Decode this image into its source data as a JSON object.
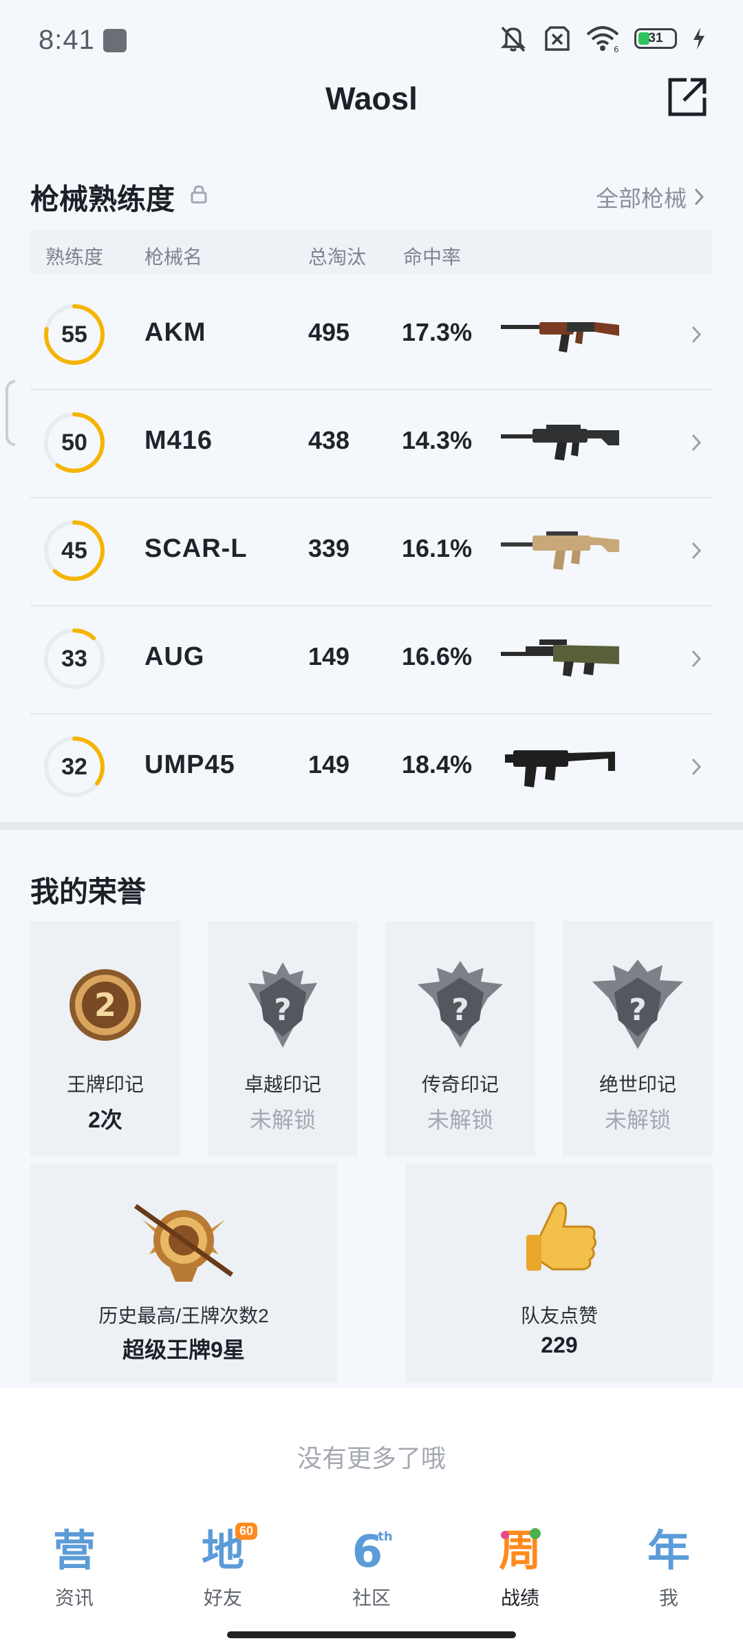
{
  "status_bar": {
    "time": "8:41",
    "battery_level": "31",
    "wifi_label": "6",
    "icons": [
      "mute-icon",
      "sim-off-icon",
      "wifi-icon",
      "battery-icon",
      "charging-icon"
    ]
  },
  "header": {
    "title": "Waosl",
    "share_icon": "share-icon"
  },
  "weapons": {
    "section_title": "枪械熟练度",
    "all_link": "全部枪械",
    "columns": [
      "熟练度",
      "枪械名",
      "总淘汰",
      "命中率"
    ],
    "rows": [
      {
        "proficiency": "55",
        "proficiency_fill": 0.78,
        "name": "AKM",
        "kills": "495",
        "hit_rate": "17.3%",
        "icon": "akm-rifle-icon"
      },
      {
        "proficiency": "50",
        "proficiency_fill": 0.6,
        "name": "M416",
        "kills": "438",
        "hit_rate": "14.3%",
        "icon": "m416-rifle-icon"
      },
      {
        "proficiency": "45",
        "proficiency_fill": 0.62,
        "name": "SCAR-L",
        "kills": "339",
        "hit_rate": "16.1%",
        "icon": "scar-l-rifle-icon"
      },
      {
        "proficiency": "33",
        "proficiency_fill": 0.12,
        "name": "AUG",
        "kills": "149",
        "hit_rate": "16.6%",
        "icon": "aug-rifle-icon"
      },
      {
        "proficiency": "32",
        "proficiency_fill": 0.35,
        "name": "UMP45",
        "kills": "149",
        "hit_rate": "18.4%",
        "icon": "ump45-smg-icon"
      }
    ]
  },
  "honors": {
    "section_title": "我的荣誉",
    "marks": [
      {
        "name": "王牌印记",
        "value": "2次",
        "badge_number": "2",
        "locked": false
      },
      {
        "name": "卓越印记",
        "value": "未解锁",
        "badge_number": "?",
        "locked": true
      },
      {
        "name": "传奇印记",
        "value": "未解锁",
        "badge_number": "?",
        "locked": true
      },
      {
        "name": "绝世印记",
        "value": "未解锁",
        "badge_number": "?",
        "locked": true
      }
    ],
    "highest": {
      "label": "历史最高/王牌次数2",
      "value": "超级王牌9星"
    },
    "likes": {
      "label": "队友点赞",
      "value": "229"
    }
  },
  "footer": {
    "no_more": "没有更多了哦"
  },
  "tab_bar": {
    "items": [
      {
        "label": "资讯",
        "glyph": "营",
        "icon": "news-tab-icon",
        "active": false
      },
      {
        "label": "好友",
        "glyph": "地",
        "icon": "friends-tab-icon",
        "badge": "60",
        "active": false
      },
      {
        "label": "社区",
        "glyph": "6",
        "glyph_sup": "th",
        "icon": "community-tab-icon",
        "active": false
      },
      {
        "label": "战绩",
        "glyph": "周",
        "icon": "stats-tab-icon",
        "active": true
      },
      {
        "label": "我",
        "glyph": "年",
        "icon": "me-tab-icon",
        "active": false
      }
    ]
  },
  "colors": {
    "accent": "#f5b400",
    "ring_track": "#e8ebf0",
    "tab_blue": "#5b9bd8",
    "tab_active_orange": "#ff8a1e"
  }
}
